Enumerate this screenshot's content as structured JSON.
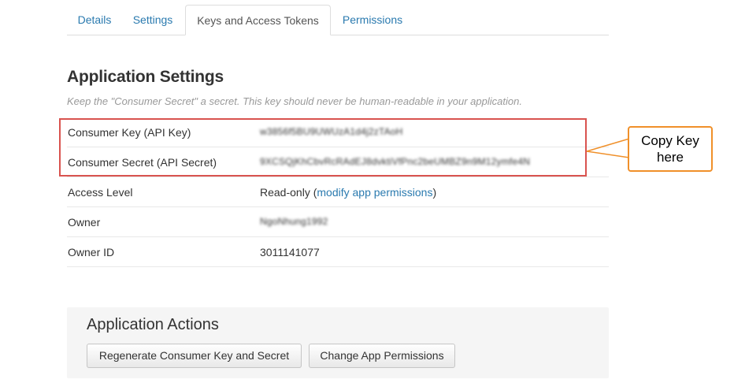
{
  "tabs": [
    {
      "label": "Details",
      "active": false
    },
    {
      "label": "Settings",
      "active": false
    },
    {
      "label": "Keys and Access Tokens",
      "active": true
    },
    {
      "label": "Permissions",
      "active": false
    }
  ],
  "page_title": "Application Settings",
  "subtitle": "Keep the \"Consumer Secret\" a secret. This key should never be human-readable in your application.",
  "settings": {
    "consumer_key": {
      "label": "Consumer Key (API Key)",
      "value": "w3856f5BU9UWUzA1d4j2zTAoH"
    },
    "consumer_secret": {
      "label": "Consumer Secret (API Secret)",
      "value": "9XCSQjKhCbvRcRAdEJ8dvktiVfPnc2beUMBZ9n9M12ymfe4N"
    },
    "access_level": {
      "label": "Access Level",
      "value": "Read-only",
      "paren_open": " (",
      "link": "modify app permissions",
      "paren_close": ")"
    },
    "owner": {
      "label": "Owner",
      "value": "NgoNhung1992"
    },
    "owner_id": {
      "label": "Owner ID",
      "value": "3011141077"
    }
  },
  "callout": {
    "line1": "Copy Key",
    "line2": "here",
    "border_color": "#f0902a"
  },
  "highlight_color": "#d9534f",
  "actions": {
    "title": "Application Actions",
    "regenerate_label": "Regenerate Consumer Key and Secret",
    "change_label": "Change App Permissions"
  },
  "colors": {
    "link": "#2a7aaf",
    "panel_bg": "#f5f5f5"
  }
}
